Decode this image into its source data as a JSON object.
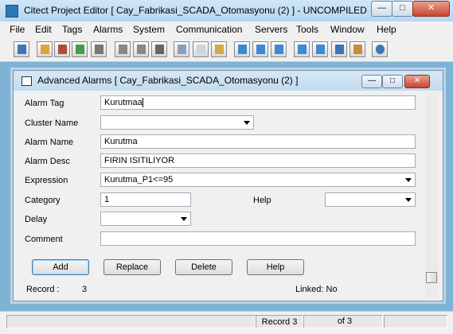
{
  "window": {
    "title": "Citect Project Editor [ Cay_Fabrikasi_SCADA_Otomasyonu (2) ] - UNCOMPILED"
  },
  "menu": [
    "File",
    "Edit",
    "Tags",
    "Alarms",
    "System",
    "Communication",
    "Servers",
    "Tools",
    "Window",
    "Help"
  ],
  "toolbar": {
    "icons": [
      "project-icon",
      "book-icon",
      "library-icon",
      "graphics-icon",
      "page-list-icon",
      "copy-page-icon",
      "paste-page-icon",
      "print-icon",
      "cut-icon",
      "copy-icon",
      "paste-icon",
      "back-arrow-icon",
      "forward-arrow-icon",
      "replace-arrow-icon",
      "save-down-icon",
      "tag-icon",
      "find-icon",
      "compile-icon",
      "help-icon"
    ]
  },
  "child": {
    "title": "Advanced Alarms [ Cay_Fabrikasi_SCADA_Otomasyonu (2) ]"
  },
  "form": {
    "alarm_tag_label": "Alarm Tag",
    "alarm_tag_value": "Kurutmaa",
    "cluster_name_label": "Cluster Name",
    "cluster_name_value": "",
    "alarm_name_label": "Alarm Name",
    "alarm_name_value": "Kurutma",
    "alarm_desc_label": "Alarm Desc",
    "alarm_desc_value": "FIRIN ISITILIYOR",
    "expression_label": "Expression",
    "expression_value": "Kurutma_P1<=95",
    "category_label": "Category",
    "category_value": "1",
    "help_label": "Help",
    "help_value": "",
    "delay_label": "Delay",
    "delay_value": "",
    "comment_label": "Comment",
    "comment_value": ""
  },
  "buttons": {
    "add": "Add",
    "replace": "Replace",
    "delete": "Delete",
    "help": "Help"
  },
  "record_info": {
    "record_label": "Record :",
    "record_value": "3",
    "linked": "Linked: No"
  },
  "status": {
    "record": "Record 3",
    "of": "of 3"
  }
}
